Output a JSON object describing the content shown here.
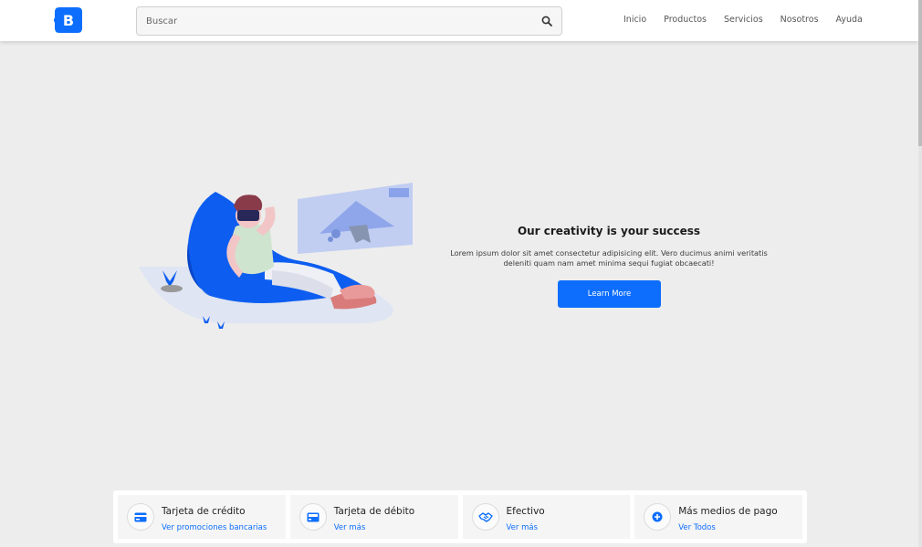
{
  "brand": {
    "logo_letter": "B",
    "color": "#0d6efd"
  },
  "search": {
    "placeholder": "Buscar",
    "icon": "search-icon"
  },
  "nav": [
    "Inicio",
    "Productos",
    "Servicios",
    "Nosotros",
    "Ayuda"
  ],
  "hero": {
    "title": "Our creativity is your success",
    "description": "Lorem ipsum dolor sit amet consectetur adipisicing elit. Vero ducimus animi veritatis deleniti quam nam amet minima sequi fugiat obcaecati!",
    "button_label": "Learn More"
  },
  "payments": [
    {
      "title": "Tarjeta de crédito",
      "link": "Ver promociones bancarias",
      "icon": "credit-card-icon"
    },
    {
      "title": "Tarjeta de débito",
      "link": "Ver más",
      "icon": "debit-card-icon"
    },
    {
      "title": "Efectivo",
      "link": "Ver más",
      "icon": "handshake-icon"
    },
    {
      "title": "Más medios de pago",
      "link": "Ver Todos",
      "icon": "plus-circle-icon"
    }
  ],
  "colors": {
    "accent": "#0d6efd",
    "background": "#ededed",
    "header": "#ffffff"
  }
}
